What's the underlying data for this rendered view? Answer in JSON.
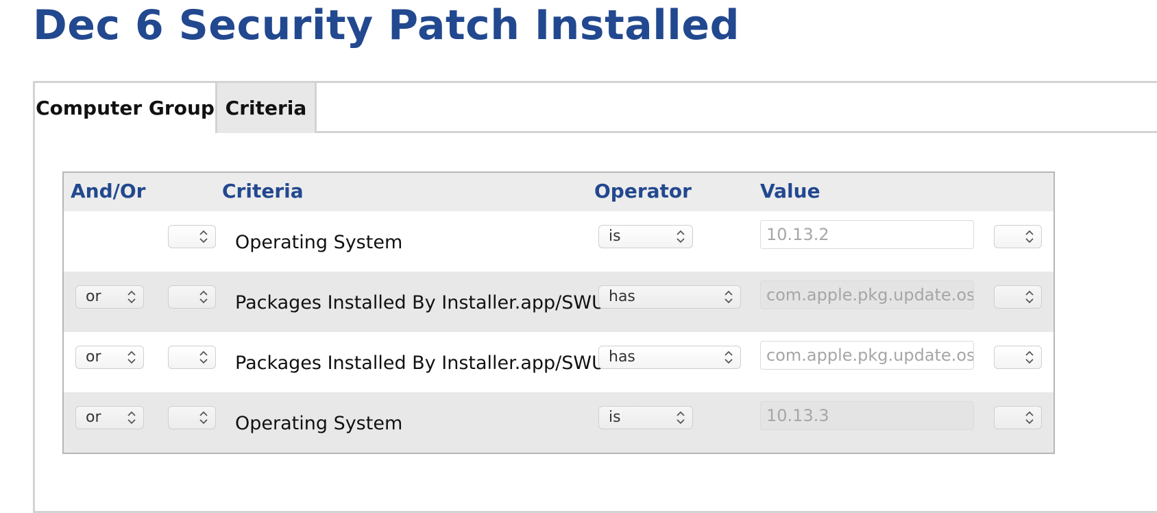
{
  "page": {
    "title": "Dec 6 Security Patch Installed"
  },
  "tabs": [
    {
      "label": "Computer Group",
      "active": false
    },
    {
      "label": "Criteria",
      "active": true
    }
  ],
  "table": {
    "headers": {
      "and_or": "And/Or",
      "criteria": "Criteria",
      "operator": "Operator",
      "value": "Value"
    },
    "rows": [
      {
        "and_or": "",
        "paren_open": "",
        "criteria": "Operating System",
        "operator": "is",
        "value": "10.13.2",
        "paren_close": ""
      },
      {
        "and_or": "or",
        "paren_open": "",
        "criteria": "Packages Installed By Installer.app/SWU",
        "operator": "has",
        "value": "com.apple.pkg.update.os.SecUpd",
        "paren_close": ""
      },
      {
        "and_or": "or",
        "paren_open": "",
        "criteria": "Packages Installed By Installer.app/SWU",
        "operator": "has",
        "value": "com.apple.pkg.update.os.SecUpd",
        "paren_close": ""
      },
      {
        "and_or": "or",
        "paren_open": "",
        "criteria": "Operating System",
        "operator": "is",
        "value": "10.13.3",
        "paren_close": ""
      }
    ]
  },
  "colors": {
    "title": "#22488f",
    "header_text": "#22488f",
    "row_alt": "#e8e8e8"
  },
  "icons": {
    "select": "up-down-chevron-icon"
  }
}
